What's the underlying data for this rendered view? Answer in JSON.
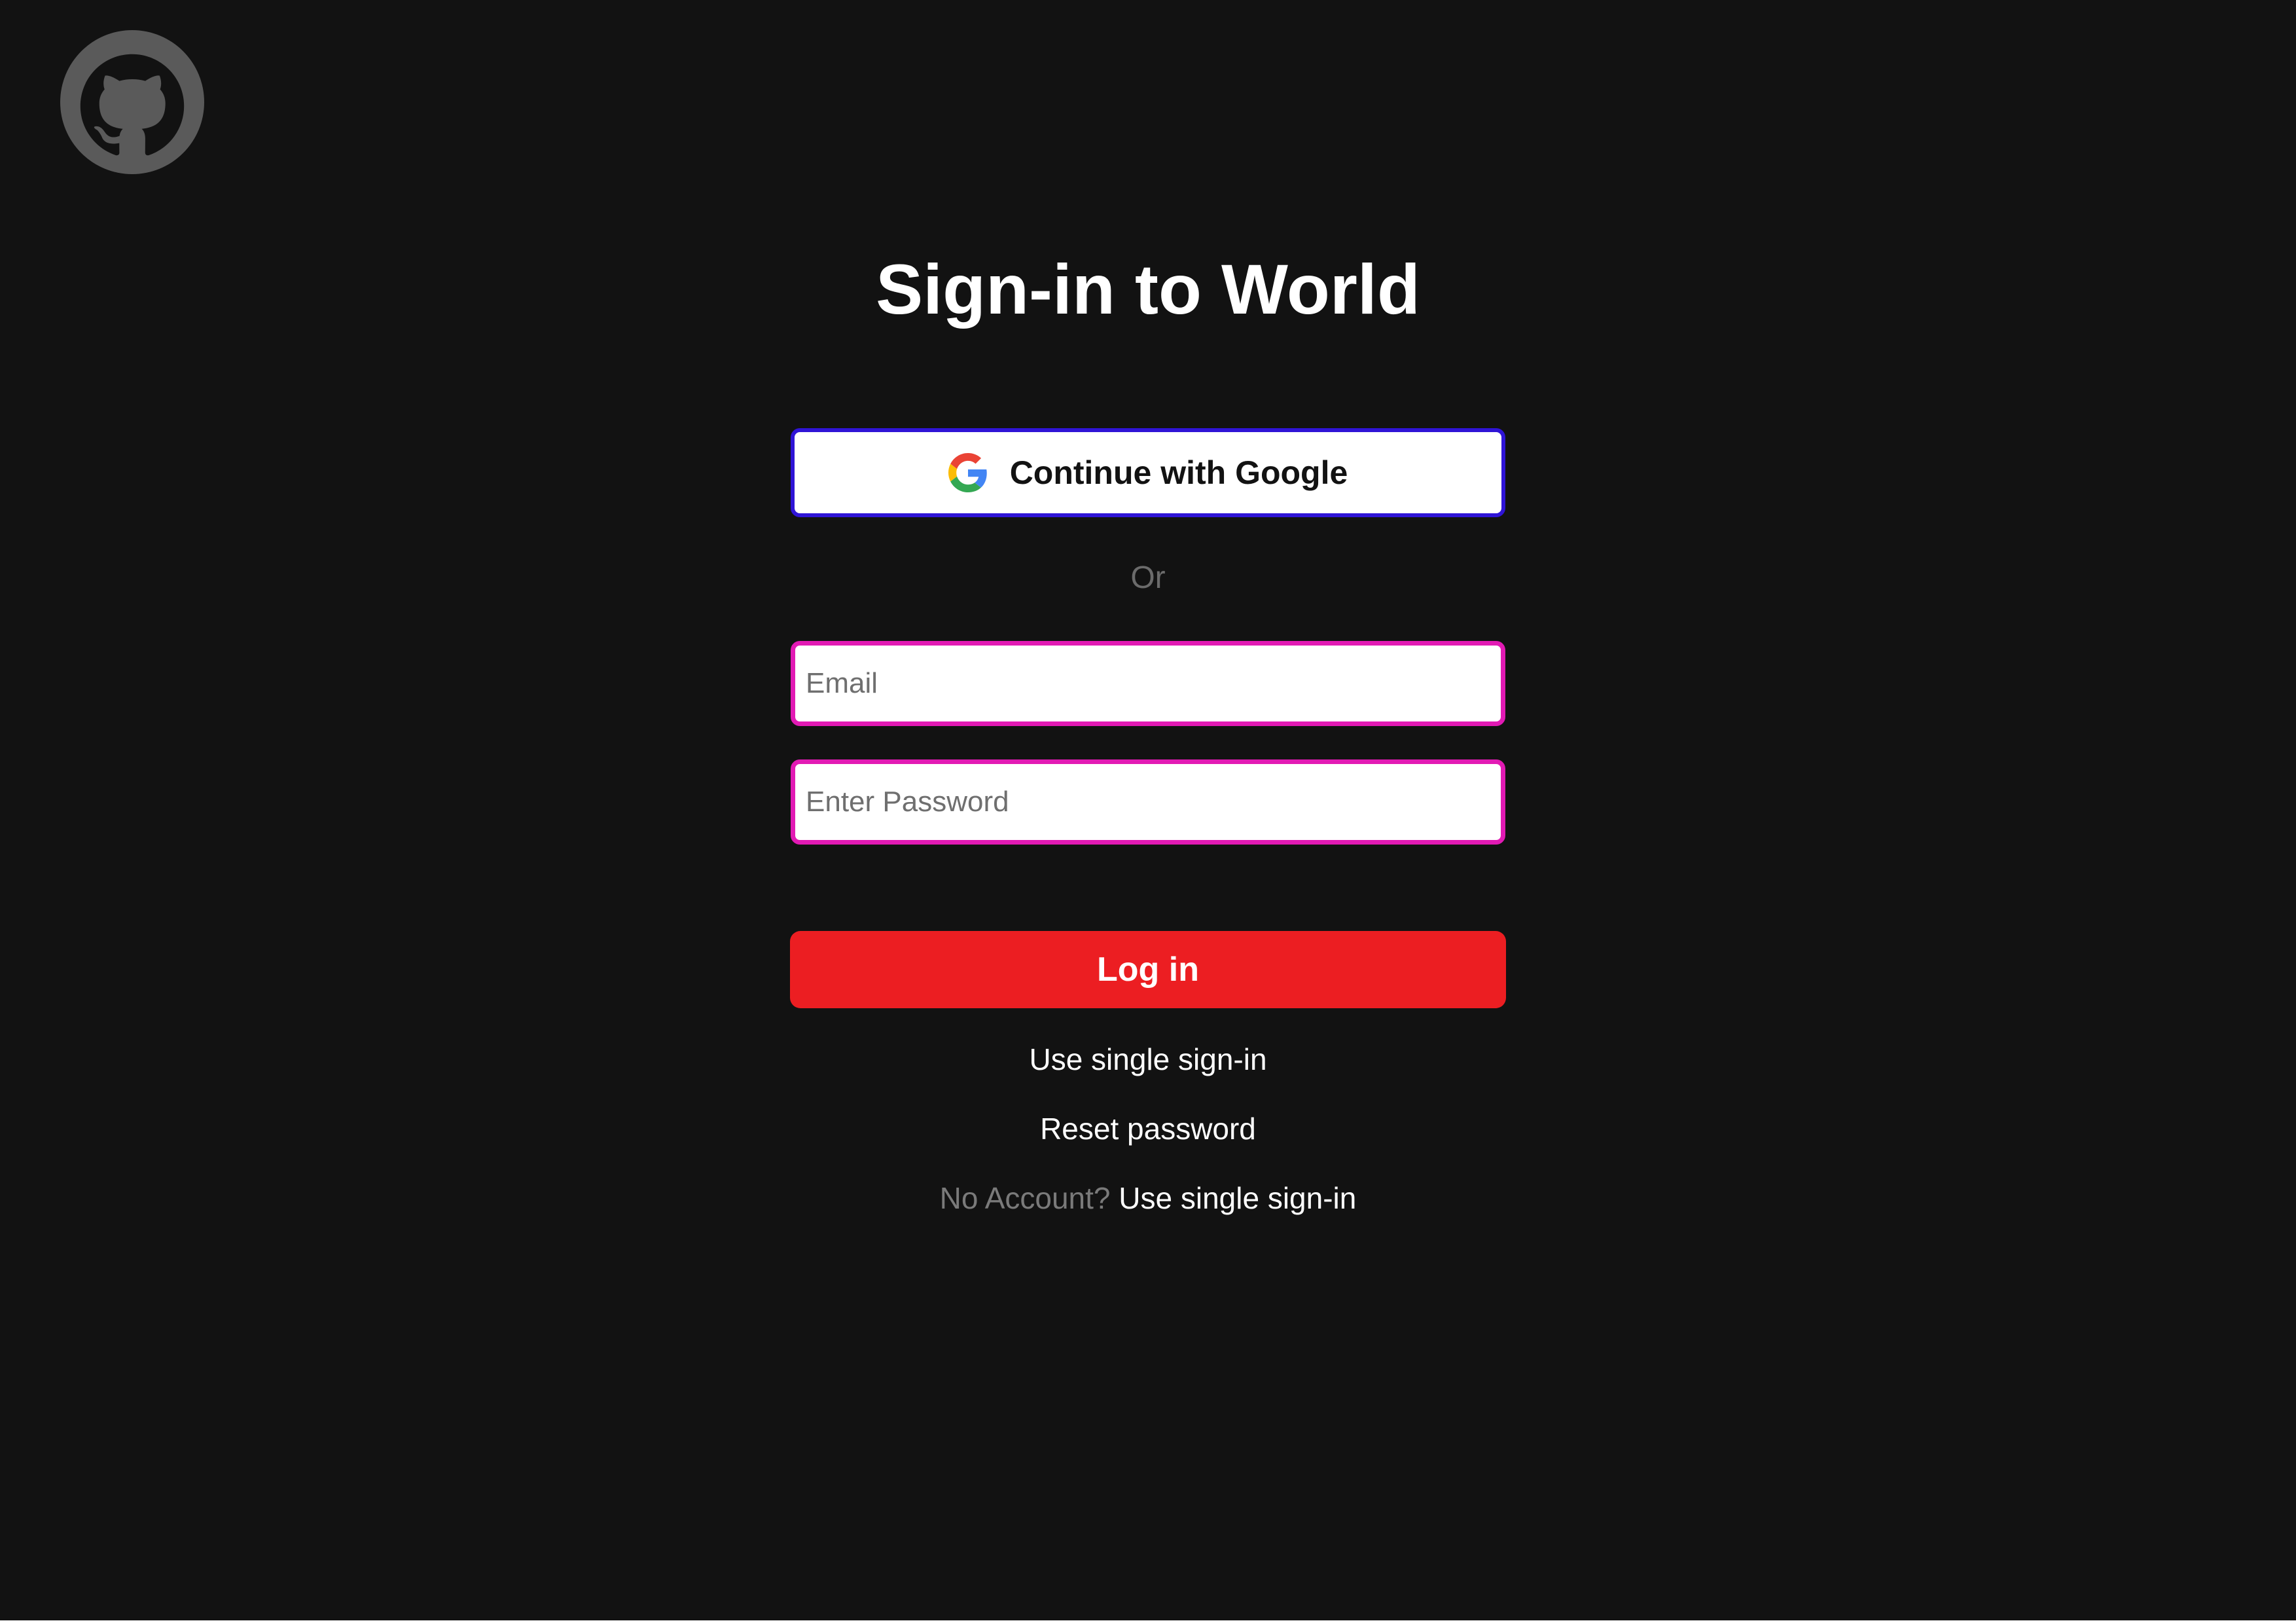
{
  "page": {
    "title": "Sign-in to World"
  },
  "header": {
    "logo_icon": "github-logo-icon"
  },
  "google_button": {
    "label": "Continue with Google",
    "icon": "google-g-icon"
  },
  "divider": {
    "label": "Or"
  },
  "form": {
    "email_placeholder": "Email",
    "email_value": "",
    "password_placeholder": "Enter Password",
    "password_value": "",
    "login_label": "Log in"
  },
  "links": {
    "single_sign_in": "Use single sign-in",
    "reset_password": "Reset password",
    "no_account_prompt": "No Account?",
    "no_account_action": "Use single sign-in"
  },
  "colors": {
    "background": "#121212",
    "google_border": "#2f14d6",
    "field_border": "#e21ab4",
    "login_button": "#ec1e22",
    "muted_text": "#7a7a7a"
  }
}
